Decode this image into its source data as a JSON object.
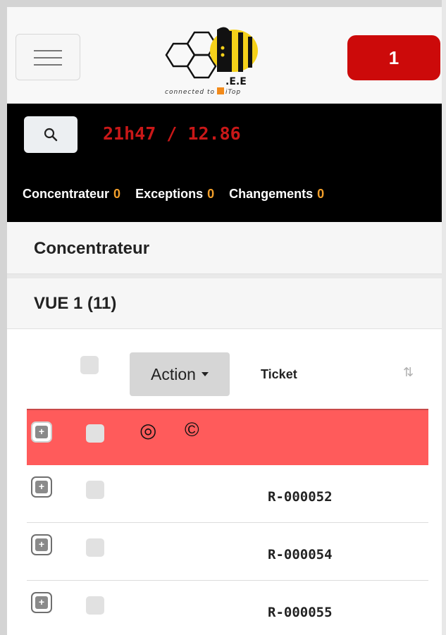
{
  "header": {
    "menu_label": "",
    "notification_count": "1",
    "logo": {
      "caption_prefix": "connected to",
      "caption_brand": "iTop",
      "mark_text": "B.E.E"
    }
  },
  "status_bar": {
    "clock": "21h47 / 12.86",
    "counters": [
      {
        "label": "Concentrateur",
        "value": "0"
      },
      {
        "label": "Exceptions",
        "value": "0"
      },
      {
        "label": "Changements",
        "value": "0"
      }
    ]
  },
  "section": {
    "title": "Concentrateur",
    "view_title": "VUE 1 (11)"
  },
  "table": {
    "action_label": "Action",
    "ticket_header": "Ticket",
    "rows": [
      {
        "ticket": "",
        "highlighted": true,
        "status_icons": [
          "◎",
          "©"
        ]
      },
      {
        "ticket": "R-000052",
        "highlighted": false
      },
      {
        "ticket": "R-000054",
        "highlighted": false
      },
      {
        "ticket": "R-000055",
        "highlighted": false
      }
    ]
  },
  "colors": {
    "alert_red": "#cc0a0a",
    "clock_red": "#c91818",
    "counter_orange": "#f4a02b",
    "highlight_row": "#ff5b5b",
    "logo_yellow": "#f5d11a"
  },
  "icons": [
    "menu-icon",
    "search-icon",
    "sort-icon",
    "expand-icon",
    "bullseye-icon",
    "copyright-icon"
  ]
}
